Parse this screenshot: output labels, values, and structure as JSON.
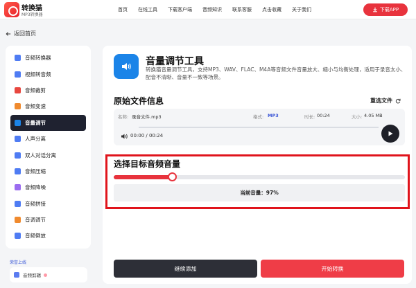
{
  "header": {
    "brand": "转换猫",
    "brand_sub": "MP3转换器",
    "logo_label": "MP3",
    "nav": [
      "首页",
      "在线工具",
      "下载客户端",
      "音频知识",
      "联系客服",
      "点击收藏",
      "关于我们"
    ],
    "download_button": "下载APP"
  },
  "back_link": "返回首页",
  "sidebar": {
    "items": [
      {
        "label": "音频转换器",
        "icon": "audio-convert-icon",
        "color": "#4f7cf3"
      },
      {
        "label": "视频转音频",
        "icon": "video-to-audio-icon",
        "color": "#4f7cf3"
      },
      {
        "label": "音频裁剪",
        "icon": "audio-cut-icon",
        "color": "#e8473f"
      },
      {
        "label": "音频变速",
        "icon": "audio-speed-icon",
        "color": "#f08a2e"
      },
      {
        "label": "音量调节",
        "icon": "volume-adjust-icon",
        "color": "#1b84e8"
      },
      {
        "label": "人声分离",
        "icon": "vocal-separation-icon",
        "color": "#4f7cf3"
      },
      {
        "label": "双人对话分离",
        "icon": "dialogue-separation-icon",
        "color": "#4f7cf3"
      },
      {
        "label": "音频压缩",
        "icon": "audio-compress-icon",
        "color": "#4f7cf3"
      },
      {
        "label": "音频降噪",
        "icon": "audio-denoise-icon",
        "color": "#9b6cf0"
      },
      {
        "label": "音频拼接",
        "icon": "audio-merge-icon",
        "color": "#4f7cf3"
      },
      {
        "label": "音调调节",
        "icon": "pitch-adjust-icon",
        "color": "#f08a2e"
      },
      {
        "label": "音频倒放",
        "icon": "audio-reverse-icon",
        "color": "#4f7cf3"
      }
    ],
    "active_index": 4,
    "section_title": "荣誉上线",
    "sub_item": "音频剪辑"
  },
  "tool": {
    "title": "音量调节工具",
    "description": "转换猫音量调节工具，支持MP3、WAV、FLAC、M4A等音频文件音量放大、缩小与均衡处理，适用于录音太小、配音不清晰、音量不一致等场景。"
  },
  "file_info": {
    "heading": "原始文件信息",
    "reselect": "重选文件",
    "name_label": "名称:",
    "name": "录音文件.mp3",
    "format_label": "格式:",
    "format": "MP3",
    "duration_label": "时长:",
    "duration": "00:24",
    "size_label": "大小:",
    "size": "4.05 MB",
    "play_time": "00:00 / 00:24"
  },
  "volume": {
    "heading": "选择目标音频音量",
    "level": 0.2,
    "current_text": "当前音量：97%"
  },
  "actions": {
    "continue_add": "继续添加",
    "start_convert": "开始转换"
  },
  "colors": {
    "accent": "#e8333d",
    "highlight": "#e0141c",
    "dark": "#1f2230"
  }
}
